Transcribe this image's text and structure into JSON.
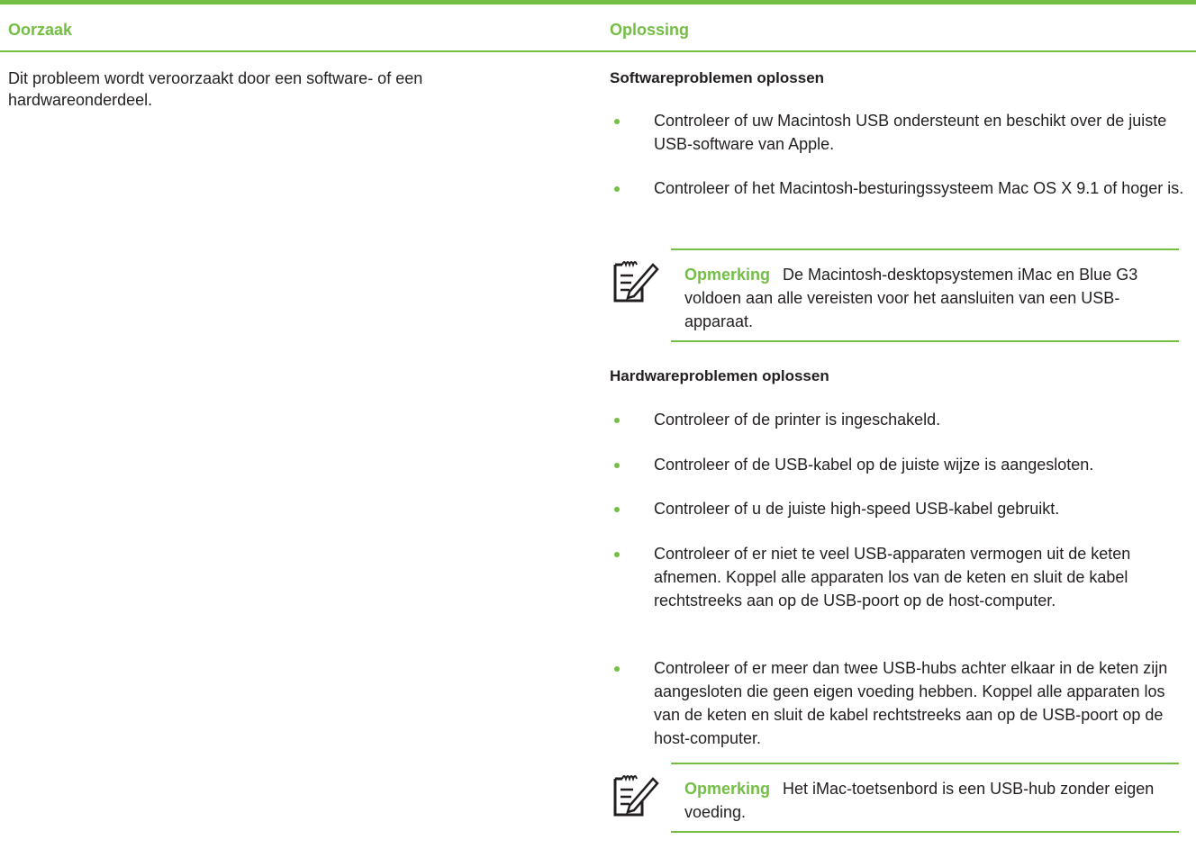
{
  "header": {
    "col_cause": "Oorzaak",
    "col_solution": "Oplossing"
  },
  "cause": {
    "text": "Dit probleem wordt veroorzaakt door een software- of een hardwareonderdeel."
  },
  "solution": {
    "software": {
      "title": "Softwareproblemen oplossen",
      "bullets": [
        "Controleer of uw Macintosh USB ondersteunt en beschikt over de juiste USB-software van Apple.",
        "Controleer of het Macintosh-besturingssysteem Mac OS X 9.1 of hoger is."
      ],
      "note": {
        "label": "Opmerking",
        "text": "De Macintosh-desktopsystemen iMac en Blue G3 voldoen aan alle vereisten voor het aansluiten van een USB-apparaat.",
        "icon": "note-pencil-icon"
      }
    },
    "hardware": {
      "title": "Hardwareproblemen oplossen",
      "bullets": [
        "Controleer of de printer is ingeschakeld.",
        "Controleer of de USB-kabel op de juiste wijze is aangesloten.",
        "Controleer of u de juiste high-speed USB-kabel gebruikt.",
        "Controleer of er niet te veel USB-apparaten vermogen uit de keten afnemen. Koppel alle apparaten los van de keten en sluit de kabel rechtstreeks aan op de USB-poort op de host-computer.",
        "Controleer of er meer dan twee USB-hubs achter elkaar in de keten zijn aangesloten die geen eigen voeding hebben. Koppel alle apparaten los van de keten en sluit de kabel rechtstreeks aan op de USB-poort op de host-computer."
      ],
      "note": {
        "label": "Opmerking",
        "text": "Het iMac-toetsenbord is een USB-hub zonder eigen voeding.",
        "icon": "note-pencil-icon"
      }
    }
  },
  "colors": {
    "accent": "#73bf44",
    "text": "#231f20"
  }
}
